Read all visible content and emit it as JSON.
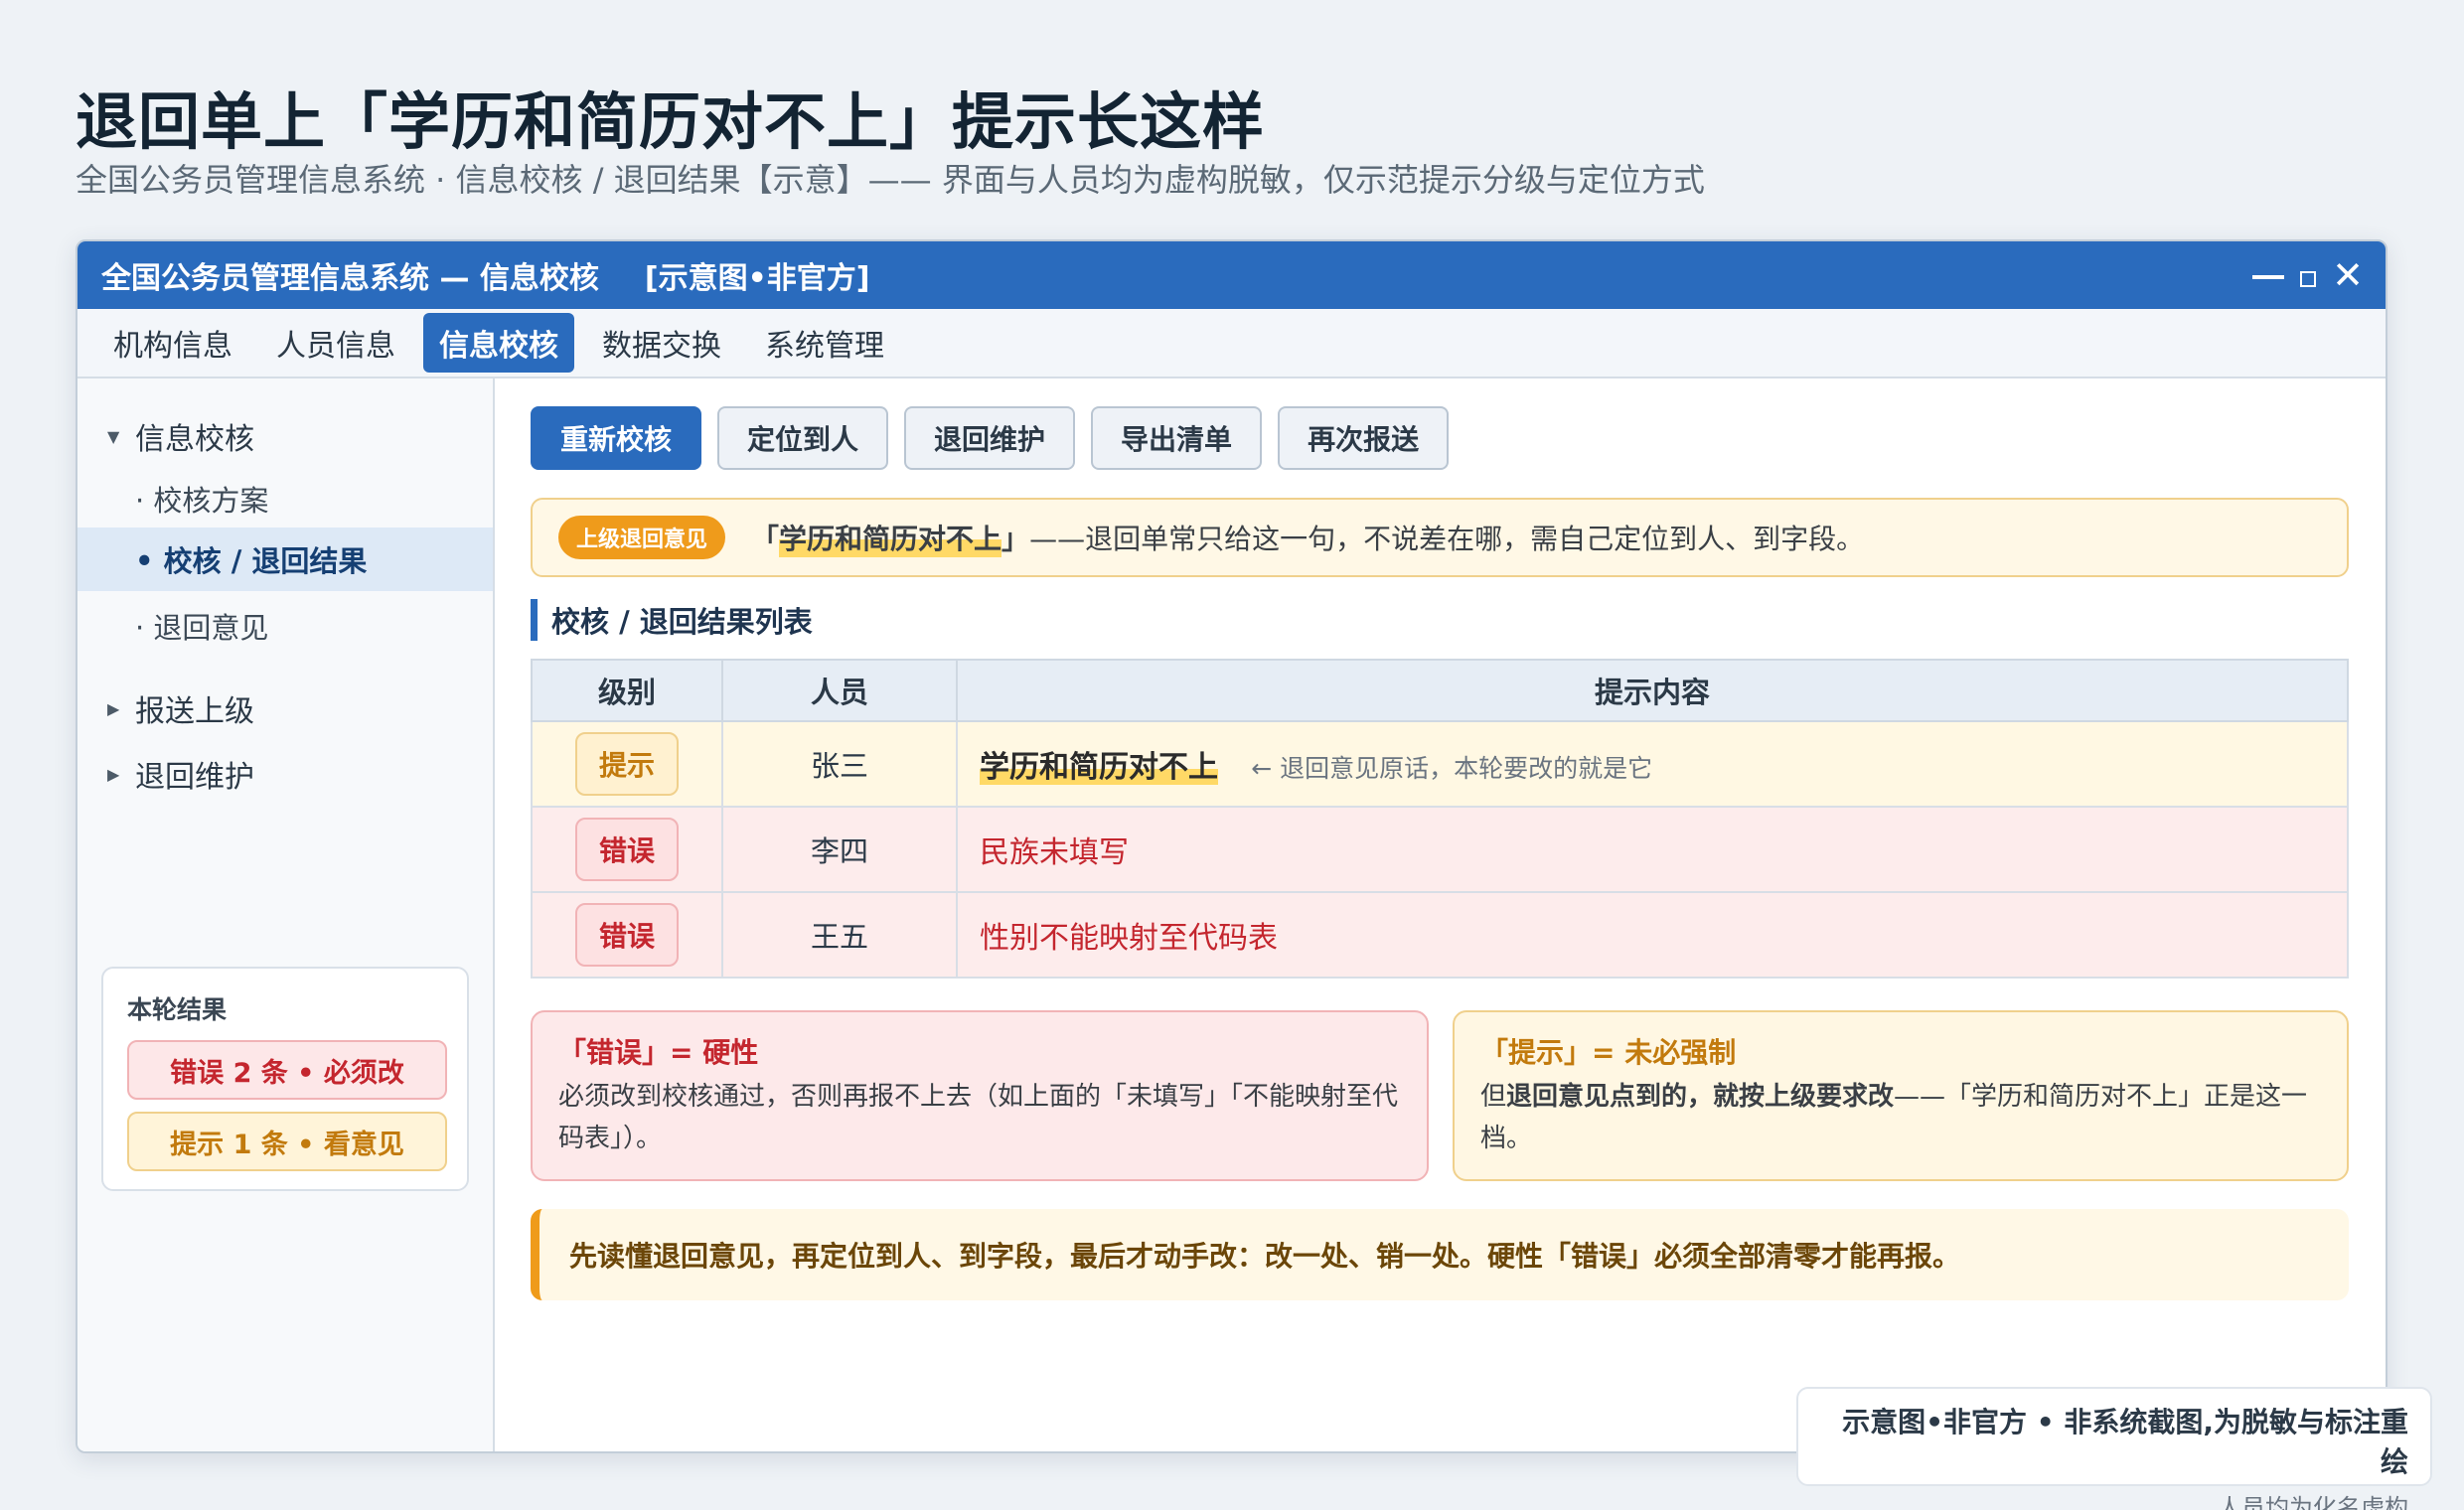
{
  "page": {
    "title": "退回单上「学历和简历对不上」提示长这样",
    "subtitle": "全国公务员管理信息系统 · 信息校核 / 退回结果【示意】—— 界面与人员均为虚构脱敏，仅示范提示分级与定位方式"
  },
  "window": {
    "title": "全国公务员管理信息系统 — 信息校核",
    "tag": "[示意图•非官方]",
    "close_glyph": "✕"
  },
  "menu": {
    "items": [
      "机构信息",
      "人员信息",
      "信息校核",
      "数据交换",
      "系统管理"
    ],
    "active": "信息校核"
  },
  "sidebar": {
    "group_verify": "信息校核",
    "child_plan": "· 校核方案",
    "child_result": "• 校核 / 退回结果",
    "child_opinion": "· 退回意见",
    "group_report": "报送上级",
    "group_maintain": "退回维护",
    "caret_open": "▼",
    "caret_closed": "▶",
    "summary": {
      "title": "本轮结果",
      "errors": "错误 2 条 • 必须改",
      "hints": "提示 1 条 • 看意见"
    }
  },
  "toolbar": {
    "recheck": "重新校核",
    "locate": "定位到人",
    "maintain": "退回维护",
    "export": "导出清单",
    "resubmit": "再次报送"
  },
  "notice": {
    "badge": "上级退回意见",
    "quote_open": "「",
    "quote_text": "学历和简历对不上",
    "quote_close": "」",
    "rest": "——退回单常只给这一句，不说差在哪，需自己定位到人、到字段。"
  },
  "section": {
    "title": "校核 / 退回结果列表"
  },
  "table": {
    "headers": {
      "level": "级别",
      "person": "人员",
      "content": "提示内容"
    },
    "rows": [
      {
        "level": "提示",
        "person": "张三",
        "content_main": "学历和简历对不上",
        "content_note": "← 退回意见原话，本轮要改的就是它"
      },
      {
        "level": "错误",
        "person": "李四",
        "field": "民族",
        "issue": "未填写"
      },
      {
        "level": "错误",
        "person": "王五",
        "field": "性别",
        "issue": "不能映射至代码表"
      }
    ]
  },
  "explain": {
    "error_head": "「错误」= 硬性",
    "error_body": "必须改到校核通过，否则再报不上去（如上面的「未填写」「不能映射至代码表」）。",
    "hint_head": "「提示」= 未必强制",
    "hint_body_prefix": "但",
    "hint_body_bold": "退回意见点到的，就按上级要求改",
    "hint_body_suffix": "——「学历和简历对不上」正是这一档。"
  },
  "footer_note": "先读懂退回意见，再定位到人、到字段，最后才动手改：改一处、销一处。硬性「错误」必须全部清零才能再报。",
  "watermark": {
    "line1": "示意图•非官方 • 非系统截图,为脱敏与标注重绘",
    "line2": "人员均为化名虚构"
  }
}
